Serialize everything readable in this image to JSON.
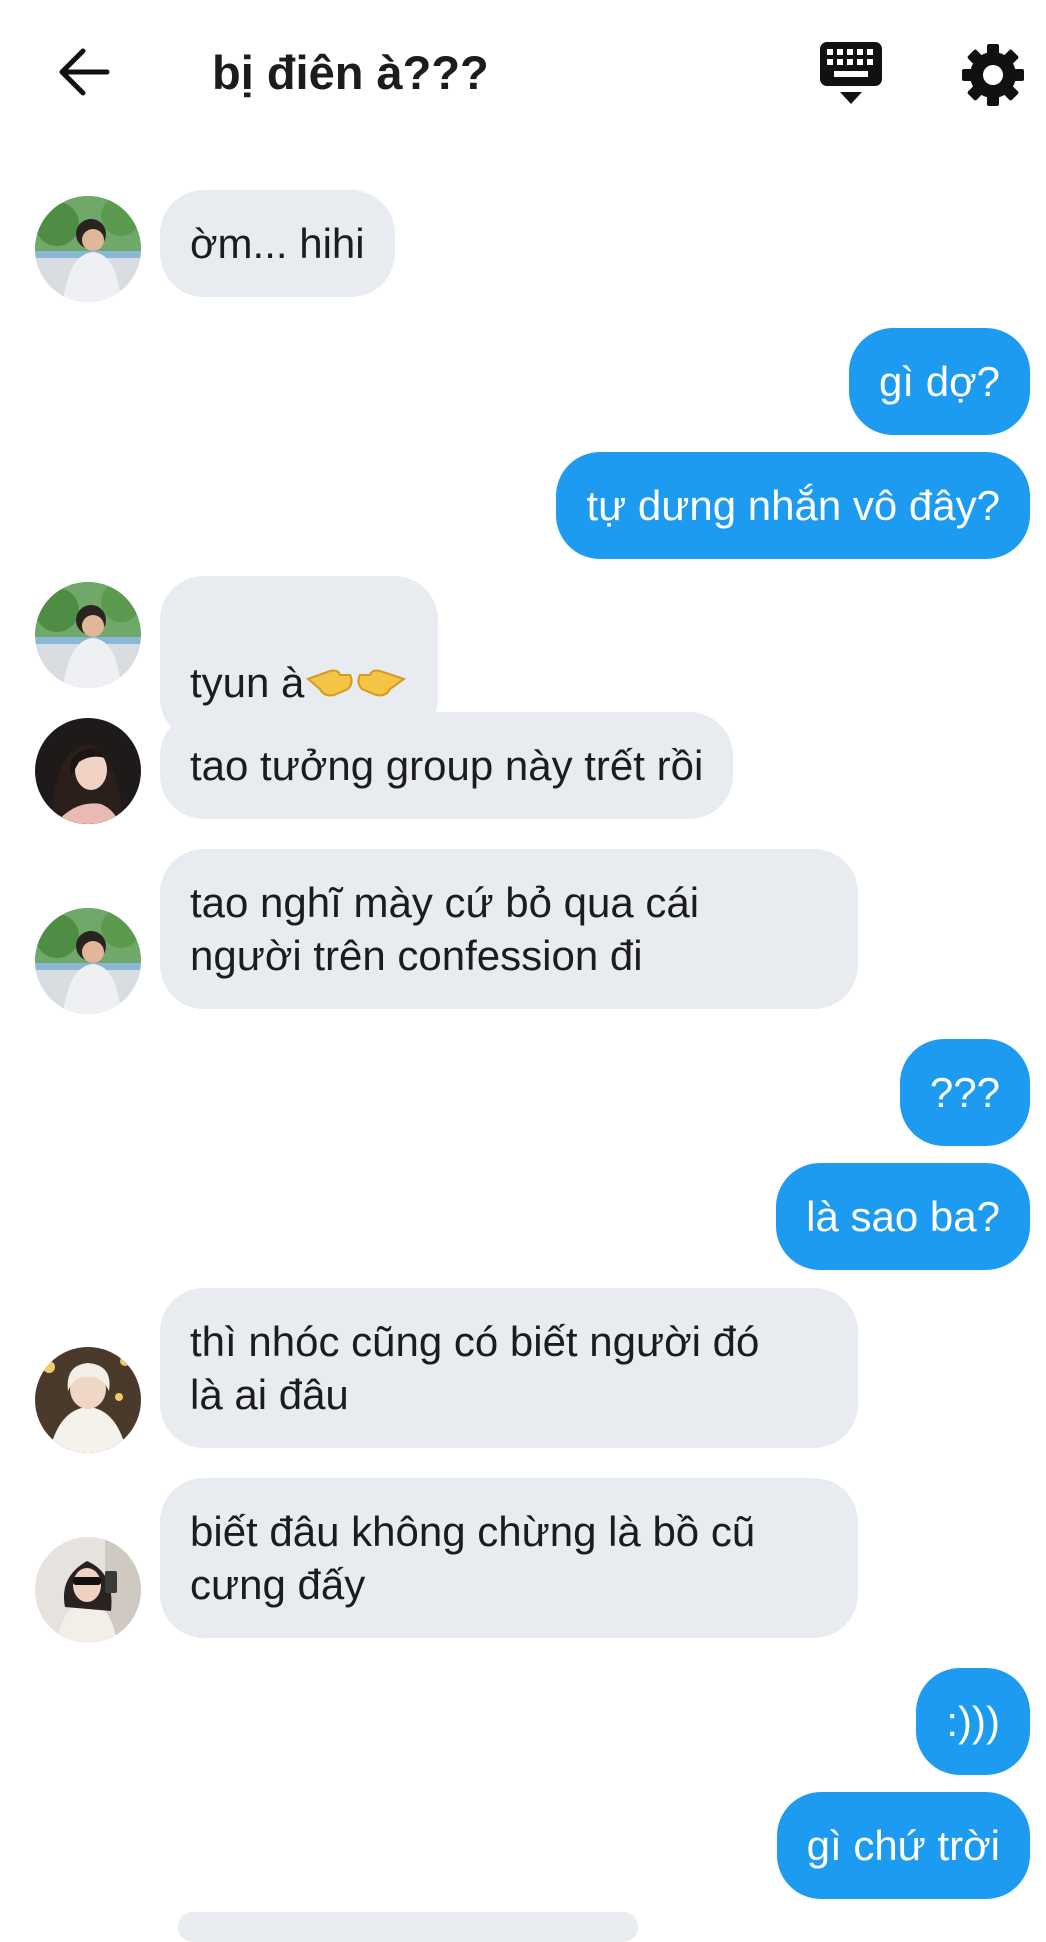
{
  "header": {
    "title": "bị điên à???",
    "back_icon": "arrow-left-icon",
    "keyboard_icon": "keyboard-icon",
    "settings_icon": "gear-icon"
  },
  "colors": {
    "incoming_bubble": "#e8ebef",
    "outgoing_bubble": "#1d9bf0",
    "text": "#1c1c1e"
  },
  "messages": [
    {
      "direction": "in",
      "sender_avatar": "avatar-boy-garden",
      "text": "ờm... hihi"
    },
    {
      "direction": "out",
      "text": "gì dợ?"
    },
    {
      "direction": "out",
      "text": "tự dưng nhắn vô đây?"
    },
    {
      "direction": "in",
      "sender_avatar": "avatar-boy-garden",
      "text": "tyun à",
      "emoji": "pointing-fingers-icon"
    },
    {
      "direction": "in",
      "sender_avatar": "avatar-girl-dark-hair",
      "text": "tao tưởng group này trết rồi"
    },
    {
      "direction": "in",
      "sender_avatar": "avatar-boy-garden",
      "text": "tao nghĩ mày cứ bỏ qua cái\nngười trên confession đi"
    },
    {
      "direction": "out",
      "text": "???"
    },
    {
      "direction": "out",
      "text": "là sao ba?"
    },
    {
      "direction": "in",
      "sender_avatar": "avatar-blonde-sweater",
      "text": "thì nhóc cũng có biết người đó\nlà ai đâu"
    },
    {
      "direction": "in",
      "sender_avatar": "avatar-girl-sunglasses",
      "text": "biết đâu không chừng là bồ cũ\ncưng đấy"
    },
    {
      "direction": "out",
      "text": ":)))"
    },
    {
      "direction": "out",
      "text": "gì chứ trời"
    }
  ]
}
